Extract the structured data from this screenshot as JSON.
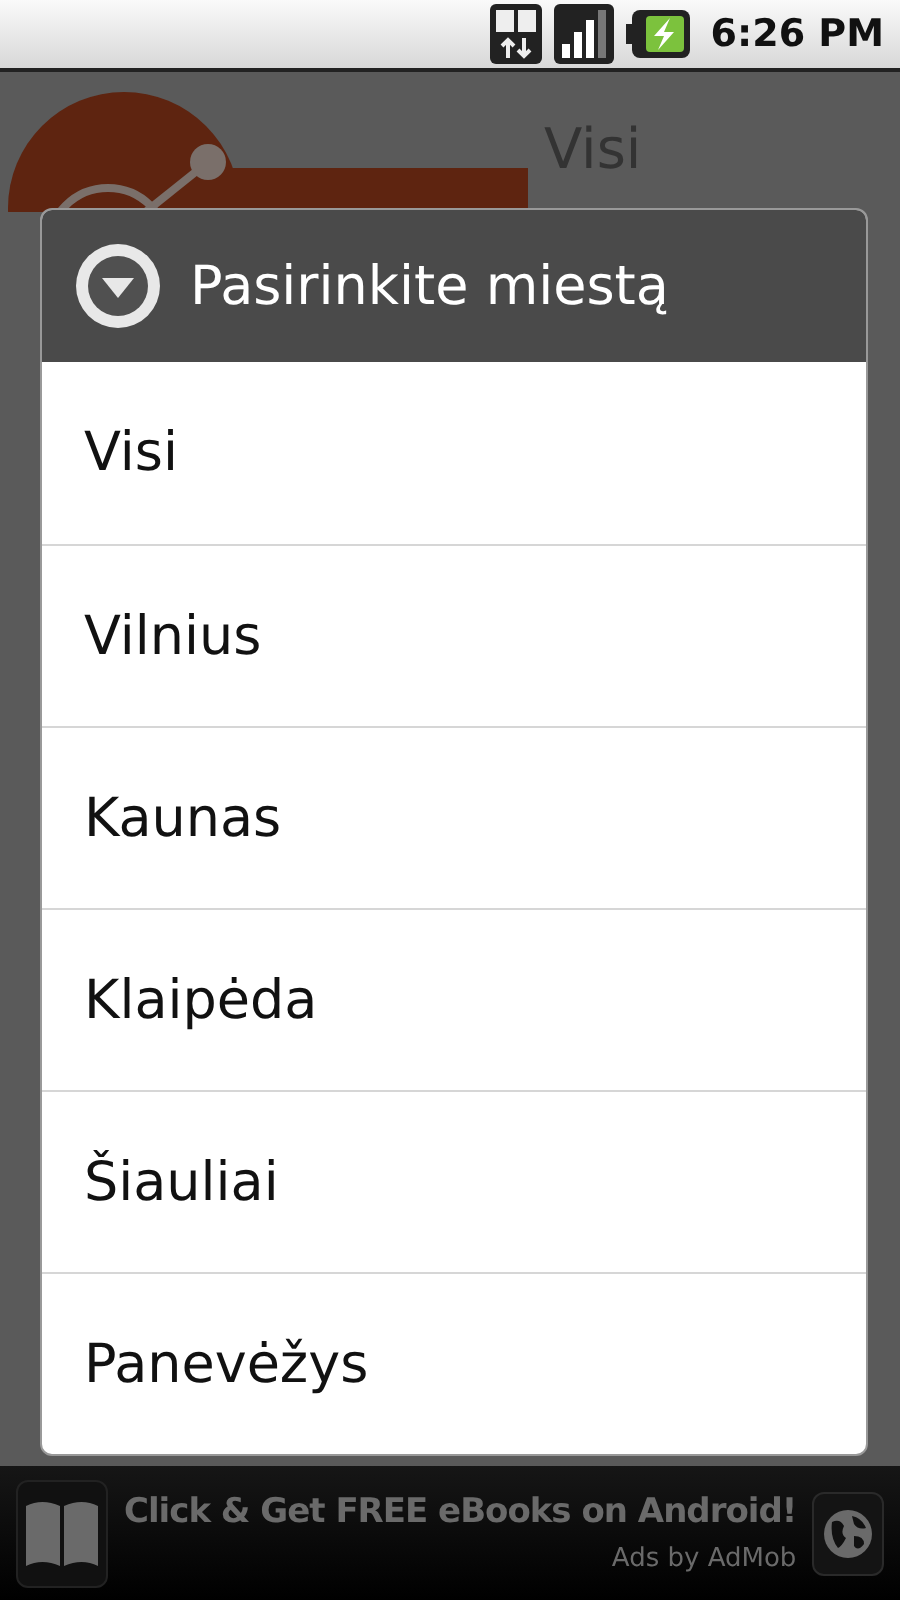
{
  "status_bar": {
    "time": "6:26 PM"
  },
  "app": {
    "title": "Visi"
  },
  "dialog": {
    "title": "Pasirinkite miestą",
    "options": [
      {
        "label": "Visi"
      },
      {
        "label": "Vilnius"
      },
      {
        "label": "Kaunas"
      },
      {
        "label": "Klaipėda"
      },
      {
        "label": "Šiauliai"
      },
      {
        "label": "Panevėžys"
      }
    ]
  },
  "ad": {
    "text": "Click & Get FREE eBooks on Android!",
    "attribution": "Ads by AdMob"
  }
}
